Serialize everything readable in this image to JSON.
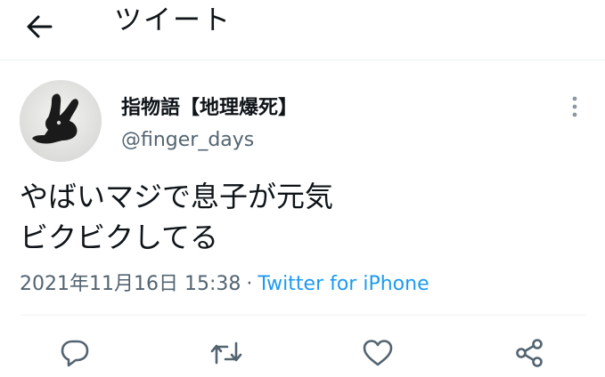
{
  "header": {
    "title": "ツイート",
    "back_icon": "arrow-left-icon"
  },
  "author": {
    "display_name": "指物語【地理爆死】",
    "username": "@finger_days",
    "avatar_icon": "rabbit-shadow-avatar"
  },
  "tweet": {
    "lines": [
      "やばいマジで息子が元気",
      "ビクビクしてる"
    ]
  },
  "meta": {
    "timestamp": "2021年11月16日 15:38",
    "separator": "·",
    "source": "Twitter for iPhone"
  },
  "actions": [
    {
      "name": "reply",
      "icon": "reply-icon"
    },
    {
      "name": "retweet",
      "icon": "retweet-icon"
    },
    {
      "name": "like",
      "icon": "heart-icon"
    },
    {
      "name": "share",
      "icon": "share-icon"
    }
  ],
  "colors": {
    "text": "#0f1419",
    "secondary": "#536471",
    "link": "#1d9bf0",
    "divider": "#eff3f4"
  }
}
